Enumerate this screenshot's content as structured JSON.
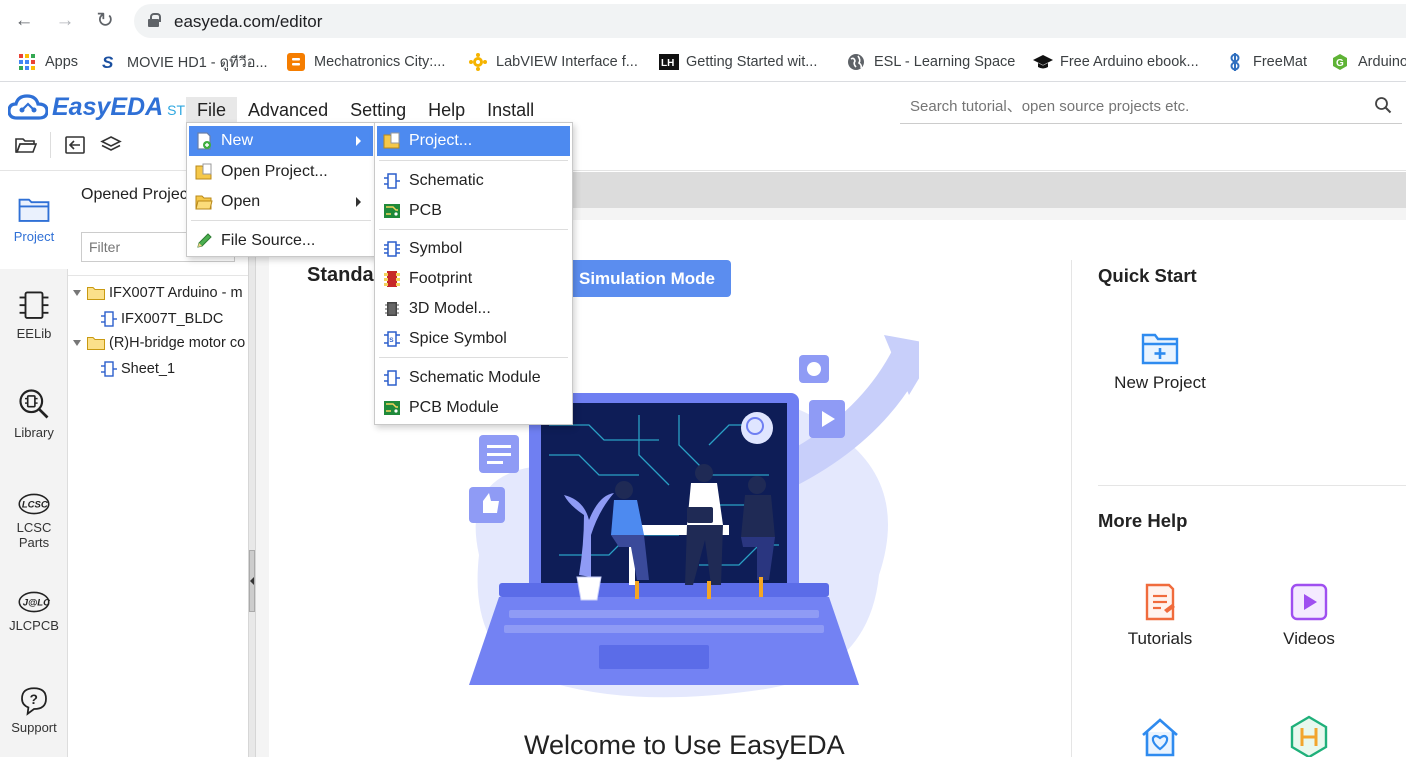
{
  "browser": {
    "url": "easyeda.com/editor",
    "bookmarks": [
      {
        "label": "Apps",
        "icon": "apps-grid-icon"
      },
      {
        "label": "MOVIE HD1 - ดูทีวีอ...",
        "icon": "movie-site-icon"
      },
      {
        "label": "Mechatronics City:...",
        "icon": "blogger-icon"
      },
      {
        "label": "LabVIEW Interface f...",
        "icon": "labview-icon"
      },
      {
        "label": "Getting Started wit...",
        "icon": "lh-site-icon"
      },
      {
        "label": "ESL - Learning Space",
        "icon": "globe-icon"
      },
      {
        "label": "Free Arduino ebook...",
        "icon": "graduation-cap-icon"
      },
      {
        "label": "FreeMat",
        "icon": "freemat-icon"
      },
      {
        "label": "Arduino",
        "icon": "arduino-site-icon"
      }
    ]
  },
  "app": {
    "logo": "EasyEDA",
    "edition": "STD",
    "menu": [
      "File",
      "Advanced",
      "Setting",
      "Help",
      "Install"
    ],
    "search_placeholder": "Search tutorial、open source projects etc."
  },
  "rail": [
    {
      "label": "Project",
      "icon": "project-folder-icon"
    },
    {
      "label": "EELib",
      "icon": "chip-icon"
    },
    {
      "label": "Library",
      "icon": "library-search-icon"
    },
    {
      "label": "LCSC Parts",
      "line1": "LCSC",
      "line2": "Parts",
      "icon": "lcsc-logo-icon"
    },
    {
      "label": "JLCPCB",
      "icon": "jlc-logo-icon"
    },
    {
      "label": "Support",
      "icon": "help-icon"
    }
  ],
  "panel": {
    "title": "Opened Projects",
    "filter_placeholder": "Filter",
    "tree": [
      {
        "label": "IFX007T Arduino - m",
        "type": "project"
      },
      {
        "label": "IFX007T_BLDC",
        "type": "schematic"
      },
      {
        "label": "(R)H-bridge motor co",
        "type": "project"
      },
      {
        "label": "Sheet_1",
        "type": "schematic"
      }
    ]
  },
  "file_menu": [
    {
      "label": "New",
      "icon": "new-file-icon",
      "submenu": true
    },
    {
      "label": "Open Project...",
      "icon": "open-project-icon"
    },
    {
      "label": "Open",
      "icon": "open-folder-icon",
      "submenu": true
    },
    {
      "label": "File Source...",
      "icon": "pencil-icon"
    }
  ],
  "new_submenu": [
    {
      "label": "Project...",
      "icon": "project-icon"
    },
    {
      "label": "Schematic",
      "icon": "schematic-icon"
    },
    {
      "label": "PCB",
      "icon": "pcb-icon"
    },
    {
      "label": "Symbol",
      "icon": "symbol-icon"
    },
    {
      "label": "Footprint",
      "icon": "footprint-icon"
    },
    {
      "label": "3D Model...",
      "icon": "3d-model-icon"
    },
    {
      "label": "Spice Symbol",
      "icon": "spice-symbol-icon"
    },
    {
      "label": "Schematic Module",
      "icon": "schematic-module-icon"
    },
    {
      "label": "PCB Module",
      "icon": "pcb-module-icon"
    }
  ],
  "welcome": {
    "standard_label": "Standa",
    "simulation_button": "Simulation Mode",
    "title": "Welcome to Use EasyEDA",
    "quick_start_title": "Quick Start",
    "new_project": "New Project",
    "more_help_title": "More Help",
    "tutorials": "Tutorials",
    "videos": "Videos"
  },
  "colors": {
    "accent": "#4d8af0",
    "brand": "#2f70d6",
    "simulation_button": "#5b8def",
    "illustration": "#6f7ff2"
  }
}
